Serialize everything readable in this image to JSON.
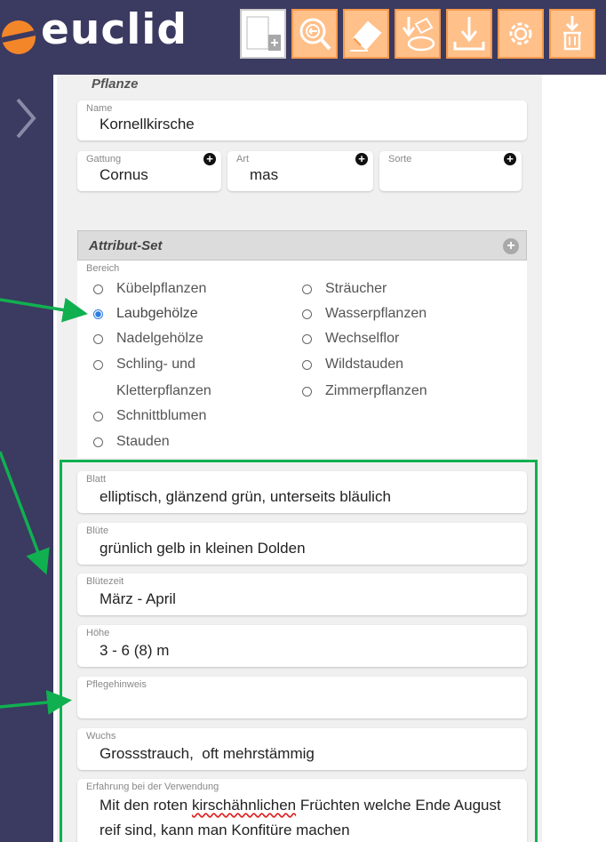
{
  "app": {
    "name": "euclid"
  },
  "toolbar": {
    "items": [
      {
        "name": "new-document-icon"
      },
      {
        "name": "back-search-icon"
      },
      {
        "name": "eraser-icon"
      },
      {
        "name": "download-disc-icon"
      },
      {
        "name": "download-icon"
      },
      {
        "name": "gear-icon"
      },
      {
        "name": "trash-download-icon"
      }
    ]
  },
  "pflanze": {
    "title": "Pflanze",
    "name_label": "Name",
    "name_value": "Kornellkirsche",
    "gattung_label": "Gattung",
    "gattung_value": "Cornus",
    "art_label": "Art",
    "art_value": "mas",
    "sorte_label": "Sorte",
    "sorte_value": ""
  },
  "attribut_set": {
    "title": "Attribut-Set",
    "bereich_label": "Bereich",
    "options_left": [
      "Kübelpflanzen",
      "Laubgehölze",
      "Nadelgehölze",
      "Schling- und",
      "Kletterpflanzen",
      "Schnittblumen",
      "Stauden"
    ],
    "options_right": [
      "Sträucher",
      "Wasserpflanzen",
      "Wechselflor",
      "Wildstauden",
      "Zimmerpflanzen"
    ],
    "selected": "Laubgehölze"
  },
  "fields": {
    "blatt_label": "Blatt",
    "blatt_value": "elliptisch, glänzend grün, unterseits bläulich",
    "bluete_label": "Blüte",
    "bluete_value": "grünlich gelb in kleinen Dolden",
    "bluetezeit_label": "Blütezeit",
    "bluetezeit_value": "März - April",
    "hoehe_label": "Höhe",
    "hoehe_value": "3 - 6 (8) m",
    "pflegehinweis_label": "Pflegehinweis",
    "pflegehinweis_value": "",
    "wuchs_label": "Wuchs",
    "wuchs_value": "Grossstrauch,  oft mehrstämmig",
    "erfahrung_label": "Erfahrung bei der Verwendung",
    "erfahrung_line1_a": "Mit den roten ",
    "erfahrung_line1_b": "kirschähnlichen",
    "erfahrung_line1_c": " Früchten welche Ende August",
    "erfahrung_line2": "reif sind, kann man Konfitüre machen"
  },
  "colors": {
    "nav": "#3b3a60",
    "accent": "#f4862a",
    "toolbar_button": "#ffc08a",
    "highlight": "#10b050",
    "radio_selected": "#2b7de0"
  }
}
